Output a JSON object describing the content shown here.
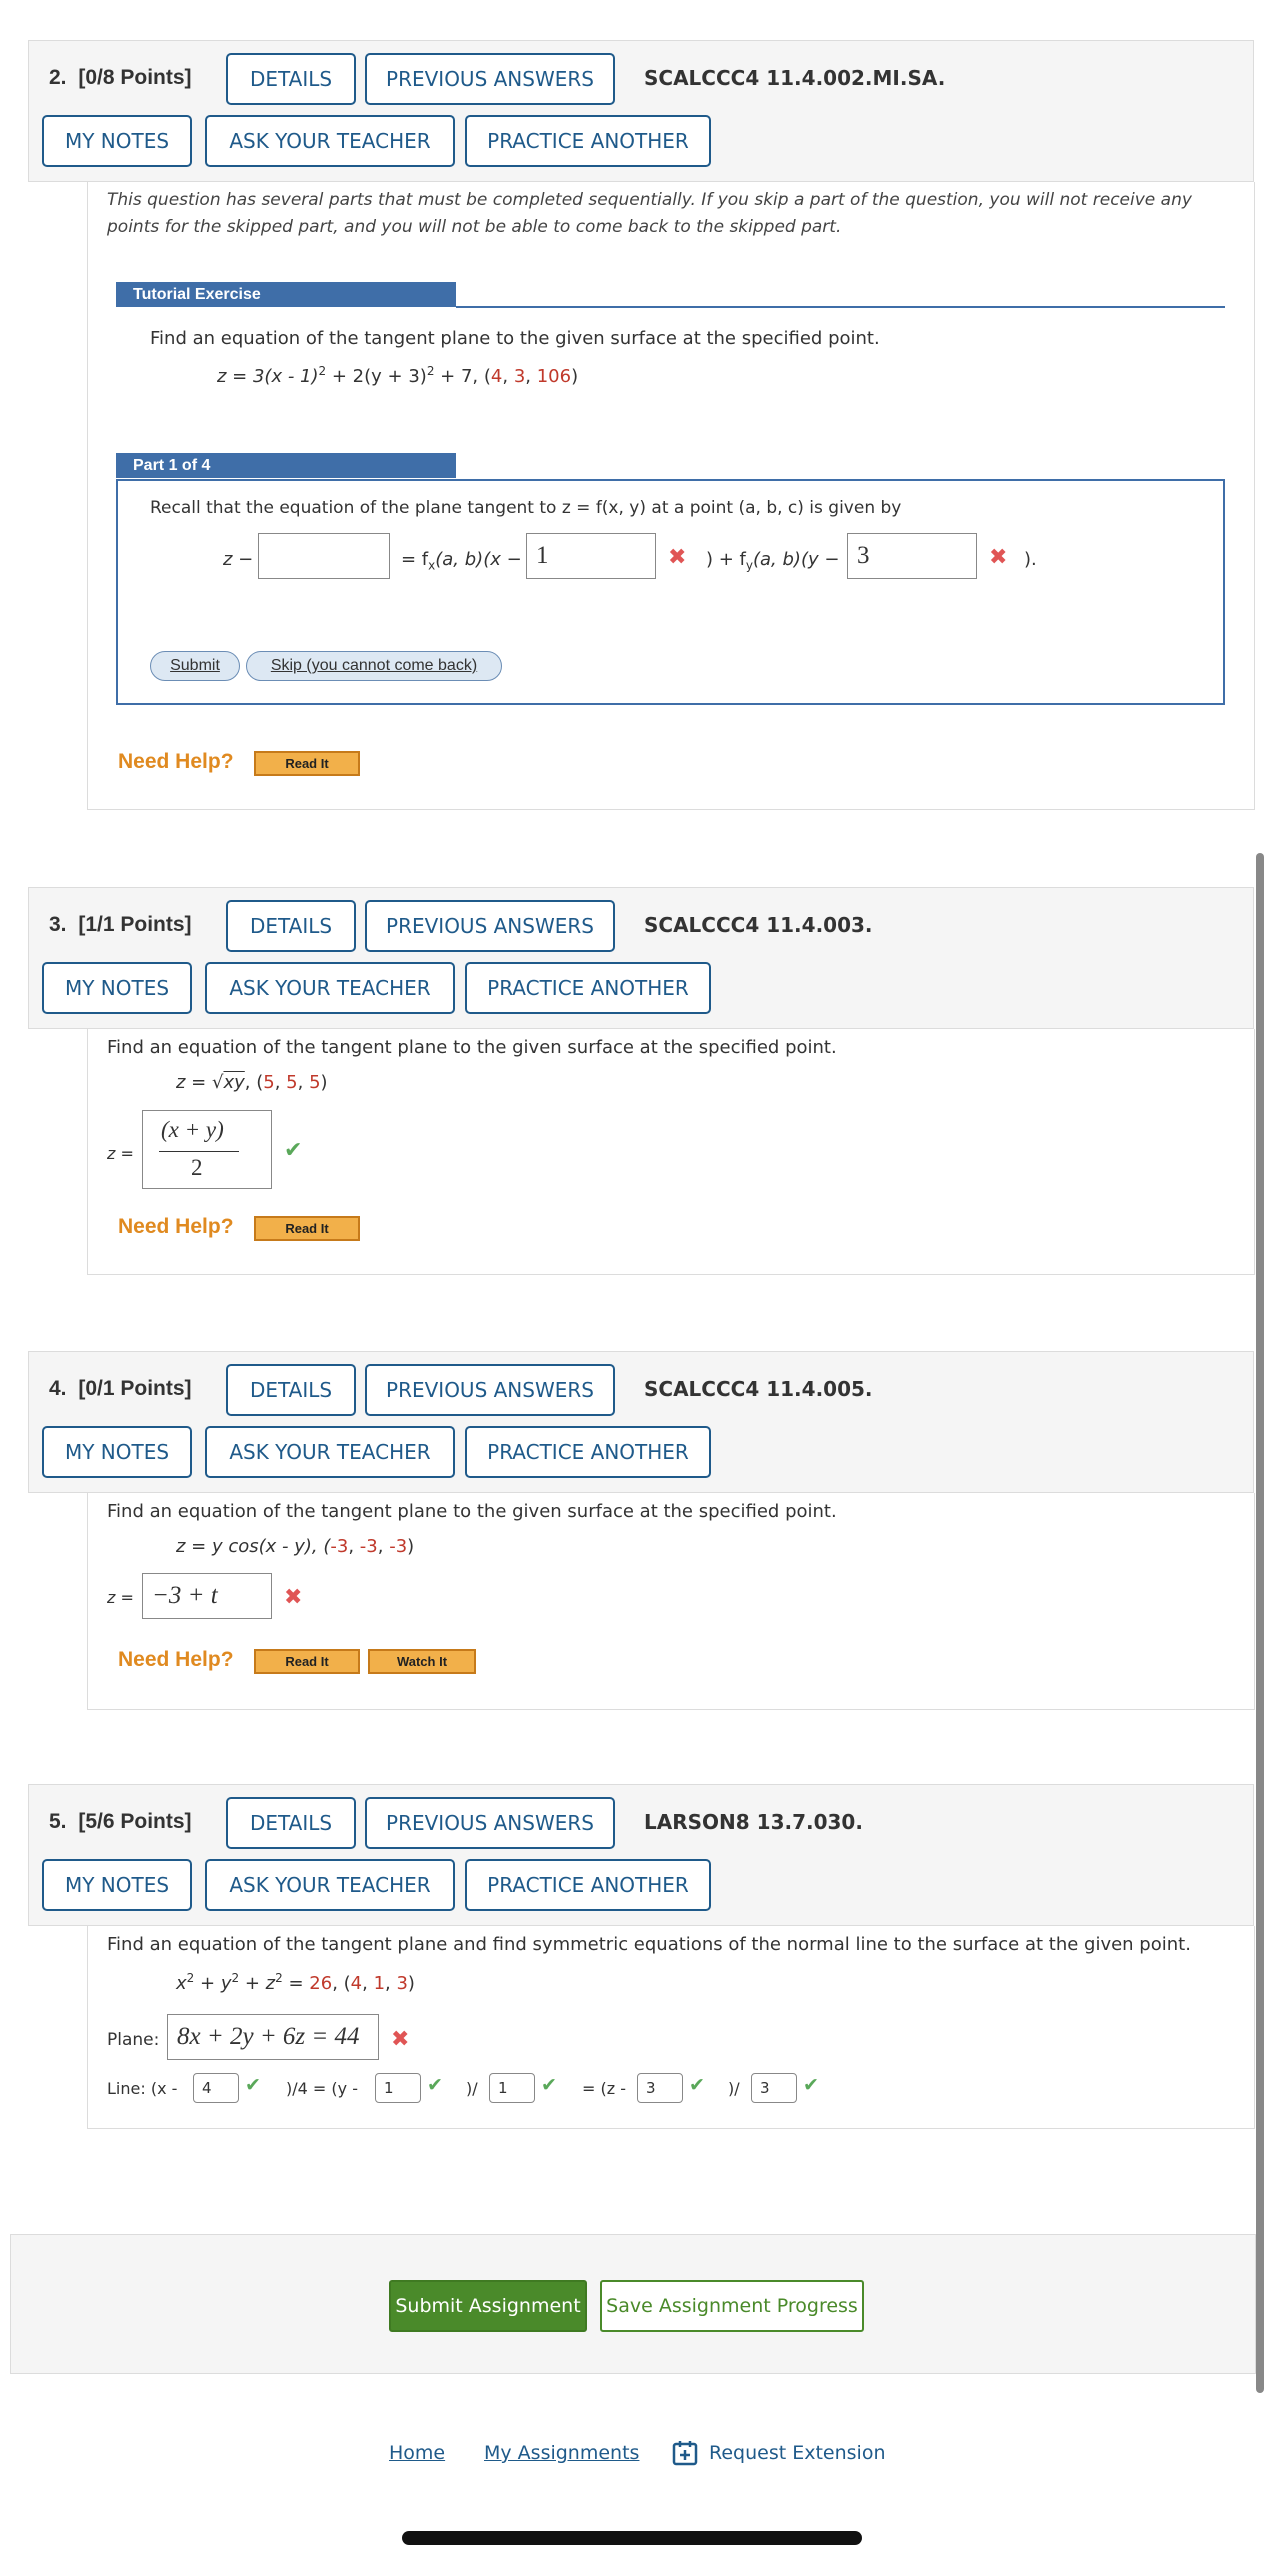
{
  "q2": {
    "num": "2.",
    "points": "[0/8 Points]",
    "details": "DETAILS",
    "prev": "PREVIOUS ANSWERS",
    "code": "SCALCCC4 11.4.002.MI.SA.",
    "notes": "MY NOTES",
    "ask": "ASK YOUR TEACHER",
    "practice": "PRACTICE ANOTHER",
    "note_line1": "This question has several parts that must be completed sequentially. If you skip a part of the question, you will not receive any",
    "note_line2": "points for the skipped part, and you will not be able to come back to the skipped part.",
    "tutorial": "Tutorial Exercise",
    "prompt": "Find an equation of the tangent plane to the given surface at the specified point.",
    "eq_pre": "z = 3(x - 1)",
    "eq_mid": " + 2(y + 3)",
    "eq_post": " + 7, (",
    "sq": "2",
    "pt_a": "4",
    "pt_b": "3",
    "pt_c": "106",
    "comma": ", ",
    "close": ")",
    "part": "Part 1 of 4",
    "recall": "Recall that the equation of the plane tangent to  z = f(x, y)  at a point  (a, b, c)  is given by",
    "z_minus": "z −",
    "eq_fx": "= f",
    "sub_x": "x",
    "fx_tail": "(a, b)(x −",
    "plus_fy": ") + f",
    "sub_y": "y",
    "fy_tail": "(a, b)(y −",
    "end": ").",
    "input1": "",
    "input2": "1",
    "input3": "3",
    "submit": "Submit",
    "skip": "Skip (you cannot come back)",
    "need_help": "Need Help?",
    "read_it": "Read It"
  },
  "q3": {
    "num": "3.",
    "points": "[1/1 Points]",
    "details": "DETAILS",
    "prev": "PREVIOUS ANSWERS",
    "code": "SCALCCC4 11.4.003.",
    "notes": "MY NOTES",
    "ask": "ASK YOUR TEACHER",
    "practice": "PRACTICE ANOTHER",
    "prompt": "Find an equation of the tangent plane to the given surface at the specified point.",
    "eq_pre": "z = ",
    "root": "√",
    "radicand": "xy",
    "eq_post": ", (",
    "pt_a": "5",
    "pt_b": "5",
    "pt_c": "5",
    "comma": ", ",
    "close": ")",
    "z_label": "z =",
    "ans_num": "(x + y)",
    "ans_den": "2",
    "need_help": "Need Help?",
    "read_it": "Read It"
  },
  "q4": {
    "num": "4.",
    "points": "[0/1 Points]",
    "details": "DETAILS",
    "prev": "PREVIOUS ANSWERS",
    "code": "SCALCCC4 11.4.005.",
    "notes": "MY NOTES",
    "ask": "ASK YOUR TEACHER",
    "practice": "PRACTICE ANOTHER",
    "prompt": "Find an equation of the tangent plane to the given surface at the specified point.",
    "eq_pre": "z = y cos(x - y), (",
    "pt_a": "-3",
    "pt_b": "-3",
    "pt_c": "-3",
    "comma": ", ",
    "close": ")",
    "z_label": "z =",
    "answer": "−3 + t",
    "need_help": "Need Help?",
    "read_it": "Read It",
    "watch_it": "Watch It"
  },
  "q5": {
    "num": "5.",
    "points": "[5/6 Points]",
    "details": "DETAILS",
    "prev": "PREVIOUS ANSWERS",
    "code": "LARSON8 13.7.030.",
    "notes": "MY NOTES",
    "ask": "ASK YOUR TEACHER",
    "practice": "PRACTICE ANOTHER",
    "prompt": "Find an equation of the tangent plane and find symmetric equations of the normal line to the surface at the given point.",
    "eq_pre": "x",
    "eq_y": " + y",
    "eq_z": " + z",
    "eq_eq": " = ",
    "rhs": "26",
    "eq_open": ", (",
    "sq": "2",
    "pt_a": "4",
    "pt_b": "1",
    "pt_c": "3",
    "comma": ", ",
    "close": ")",
    "plane_label": "Plane:",
    "plane_answer": "8x + 2y + 6z = 44",
    "line_label": "Line: (x -",
    "l_a": "4",
    "l_t1": ")/4 = (y -",
    "l_b": "1",
    "l_t2": ")/",
    "l_c": "1",
    "l_t3": "= (z -",
    "l_d": "3",
    "l_t4": ")/",
    "l_e": "3"
  },
  "submit_assignment": "Submit Assignment",
  "save_progress": "Save Assignment Progress",
  "footer": {
    "home": "Home",
    "assignments": "My Assignments",
    "extension": "Request Extension"
  },
  "colors": {
    "link_blue": "#1f5a8a",
    "tutorial_blue": "#3f6ea8",
    "point_red": "#c0392b",
    "help_orange": "#e08a20",
    "submit_green": "#4a8a2a",
    "check_green": "#5aa85a",
    "cross_red": "#e05555"
  }
}
